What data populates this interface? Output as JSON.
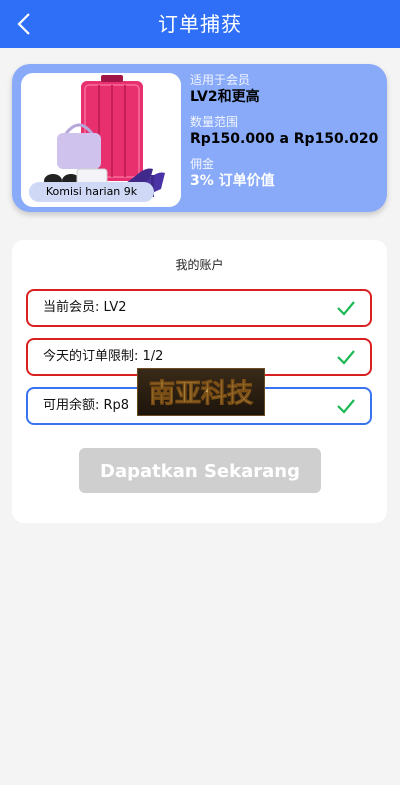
{
  "header": {
    "title": "订单捕获",
    "back_icon": "chevron-left-icon"
  },
  "product": {
    "commission_tag": "Komisi harian 9k",
    "membership_label": "适用于会员",
    "membership_value": "LV2和更高",
    "range_label": "数量范围",
    "range_value": "Rp150.000 a Rp150.020",
    "commission_label": "佣金",
    "commission_value": "3% 订单价值"
  },
  "account": {
    "title": "我的账户",
    "fields": [
      {
        "text": "当前会员: LV2",
        "status": "check-icon"
      },
      {
        "text": "今天的订单限制: 1/2",
        "status": "check-icon"
      },
      {
        "text": "可用余额: Rp8",
        "status": "check-icon"
      }
    ],
    "button_label": "Dapatkan Sekarang"
  },
  "watermark": {
    "text": "南亚科技"
  },
  "colors": {
    "header": "#2f6ef7",
    "card": "#88aaf8",
    "red_border": "#d92020",
    "blue_border": "#3874ef",
    "check": "#1db954",
    "button_disabled": "#cfcfcf"
  }
}
